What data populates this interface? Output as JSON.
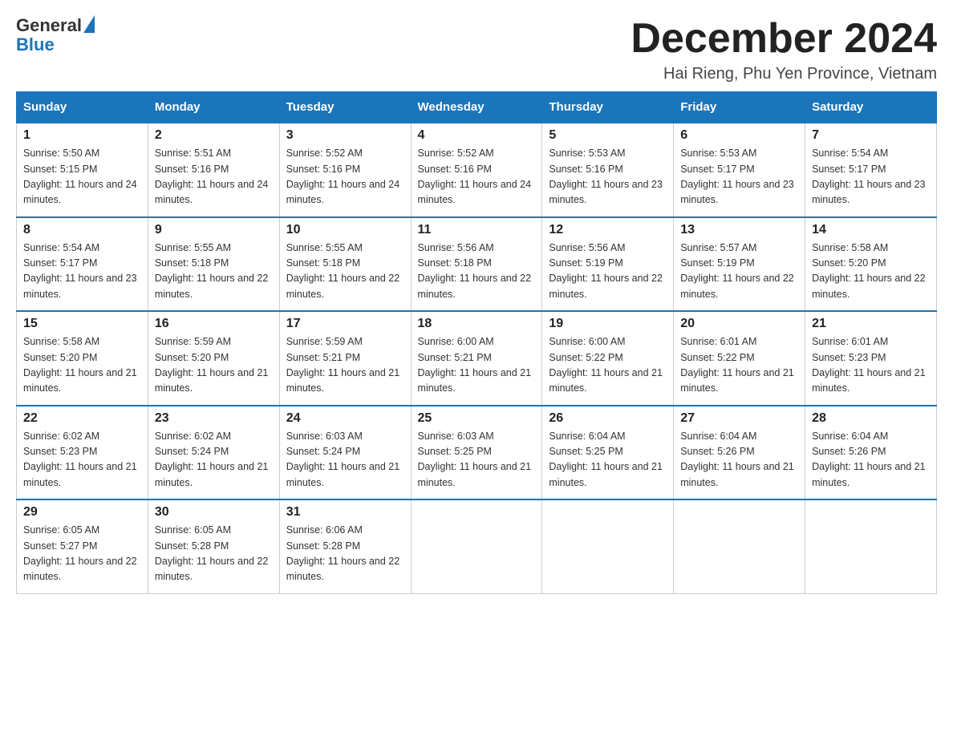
{
  "header": {
    "logo": {
      "general": "General",
      "blue": "Blue"
    },
    "title": "December 2024",
    "location": "Hai Rieng, Phu Yen Province, Vietnam"
  },
  "weekdays": [
    "Sunday",
    "Monday",
    "Tuesday",
    "Wednesday",
    "Thursday",
    "Friday",
    "Saturday"
  ],
  "weeks": [
    [
      {
        "day": "1",
        "sunrise": "5:50 AM",
        "sunset": "5:15 PM",
        "daylight": "11 hours and 24 minutes."
      },
      {
        "day": "2",
        "sunrise": "5:51 AM",
        "sunset": "5:16 PM",
        "daylight": "11 hours and 24 minutes."
      },
      {
        "day": "3",
        "sunrise": "5:52 AM",
        "sunset": "5:16 PM",
        "daylight": "11 hours and 24 minutes."
      },
      {
        "day": "4",
        "sunrise": "5:52 AM",
        "sunset": "5:16 PM",
        "daylight": "11 hours and 24 minutes."
      },
      {
        "day": "5",
        "sunrise": "5:53 AM",
        "sunset": "5:16 PM",
        "daylight": "11 hours and 23 minutes."
      },
      {
        "day": "6",
        "sunrise": "5:53 AM",
        "sunset": "5:17 PM",
        "daylight": "11 hours and 23 minutes."
      },
      {
        "day": "7",
        "sunrise": "5:54 AM",
        "sunset": "5:17 PM",
        "daylight": "11 hours and 23 minutes."
      }
    ],
    [
      {
        "day": "8",
        "sunrise": "5:54 AM",
        "sunset": "5:17 PM",
        "daylight": "11 hours and 23 minutes."
      },
      {
        "day": "9",
        "sunrise": "5:55 AM",
        "sunset": "5:18 PM",
        "daylight": "11 hours and 22 minutes."
      },
      {
        "day": "10",
        "sunrise": "5:55 AM",
        "sunset": "5:18 PM",
        "daylight": "11 hours and 22 minutes."
      },
      {
        "day": "11",
        "sunrise": "5:56 AM",
        "sunset": "5:18 PM",
        "daylight": "11 hours and 22 minutes."
      },
      {
        "day": "12",
        "sunrise": "5:56 AM",
        "sunset": "5:19 PM",
        "daylight": "11 hours and 22 minutes."
      },
      {
        "day": "13",
        "sunrise": "5:57 AM",
        "sunset": "5:19 PM",
        "daylight": "11 hours and 22 minutes."
      },
      {
        "day": "14",
        "sunrise": "5:58 AM",
        "sunset": "5:20 PM",
        "daylight": "11 hours and 22 minutes."
      }
    ],
    [
      {
        "day": "15",
        "sunrise": "5:58 AM",
        "sunset": "5:20 PM",
        "daylight": "11 hours and 21 minutes."
      },
      {
        "day": "16",
        "sunrise": "5:59 AM",
        "sunset": "5:20 PM",
        "daylight": "11 hours and 21 minutes."
      },
      {
        "day": "17",
        "sunrise": "5:59 AM",
        "sunset": "5:21 PM",
        "daylight": "11 hours and 21 minutes."
      },
      {
        "day": "18",
        "sunrise": "6:00 AM",
        "sunset": "5:21 PM",
        "daylight": "11 hours and 21 minutes."
      },
      {
        "day": "19",
        "sunrise": "6:00 AM",
        "sunset": "5:22 PM",
        "daylight": "11 hours and 21 minutes."
      },
      {
        "day": "20",
        "sunrise": "6:01 AM",
        "sunset": "5:22 PM",
        "daylight": "11 hours and 21 minutes."
      },
      {
        "day": "21",
        "sunrise": "6:01 AM",
        "sunset": "5:23 PM",
        "daylight": "11 hours and 21 minutes."
      }
    ],
    [
      {
        "day": "22",
        "sunrise": "6:02 AM",
        "sunset": "5:23 PM",
        "daylight": "11 hours and 21 minutes."
      },
      {
        "day": "23",
        "sunrise": "6:02 AM",
        "sunset": "5:24 PM",
        "daylight": "11 hours and 21 minutes."
      },
      {
        "day": "24",
        "sunrise": "6:03 AM",
        "sunset": "5:24 PM",
        "daylight": "11 hours and 21 minutes."
      },
      {
        "day": "25",
        "sunrise": "6:03 AM",
        "sunset": "5:25 PM",
        "daylight": "11 hours and 21 minutes."
      },
      {
        "day": "26",
        "sunrise": "6:04 AM",
        "sunset": "5:25 PM",
        "daylight": "11 hours and 21 minutes."
      },
      {
        "day": "27",
        "sunrise": "6:04 AM",
        "sunset": "5:26 PM",
        "daylight": "11 hours and 21 minutes."
      },
      {
        "day": "28",
        "sunrise": "6:04 AM",
        "sunset": "5:26 PM",
        "daylight": "11 hours and 21 minutes."
      }
    ],
    [
      {
        "day": "29",
        "sunrise": "6:05 AM",
        "sunset": "5:27 PM",
        "daylight": "11 hours and 22 minutes."
      },
      {
        "day": "30",
        "sunrise": "6:05 AM",
        "sunset": "5:28 PM",
        "daylight": "11 hours and 22 minutes."
      },
      {
        "day": "31",
        "sunrise": "6:06 AM",
        "sunset": "5:28 PM",
        "daylight": "11 hours and 22 minutes."
      },
      null,
      null,
      null,
      null
    ]
  ],
  "labels": {
    "sunrise": "Sunrise:",
    "sunset": "Sunset:",
    "daylight": "Daylight:"
  }
}
